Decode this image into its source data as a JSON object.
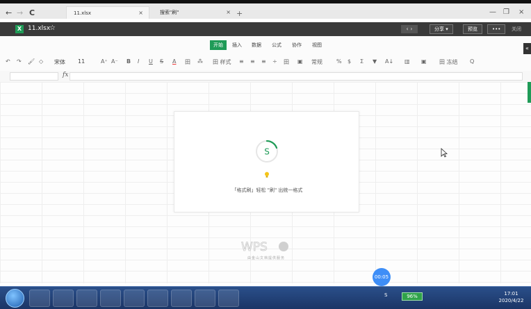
{
  "browser": {
    "back": "←",
    "forward": "→",
    "reload": "C",
    "tabs": [
      {
        "title": "11.xlsx",
        "close": "×"
      },
      {
        "title": "搜索\"刷\"",
        "close": "×"
      }
    ],
    "new_tab": "+",
    "window_controls": [
      "—",
      "❐",
      "×"
    ]
  },
  "app": {
    "file_icon_letter": "X",
    "file_name": "11.xlsx",
    "star": "☆",
    "nav_arrows": "‹ ›",
    "share_label": "分享 ▾",
    "preview_label": "预览",
    "more_label": "•••",
    "close_label": "关闭"
  },
  "ribbon": {
    "tabs": [
      "开始",
      "插入",
      "数据",
      "公式",
      "协作",
      "视图"
    ],
    "active_tab": "开始"
  },
  "toolbar": {
    "font_name": "宋体",
    "font_size": "11",
    "items": [
      "A⁺",
      "A⁻",
      "B",
      "I",
      "U",
      "S",
      "A",
      "田",
      "⁂",
      "田 样式",
      "≡",
      "≡",
      "≡",
      "÷",
      "田",
      "▣",
      "常规",
      "%",
      "$",
      "Σ",
      "▼",
      "A↓",
      "▥",
      "▣",
      "田 冻结",
      "Q"
    ]
  },
  "formula_bar": {
    "fx": "fx"
  },
  "loading": {
    "spinner_letter": "S",
    "tip": "「格式刷」轻松 \"刷\" 出统一格式"
  },
  "watermark": {
    "logo": "WPS",
    "sub": "由金山文档提供服务"
  },
  "timer": "00:05",
  "side": {
    "collapse": "«"
  },
  "taskbar": {
    "battery": "96%",
    "time": "17:01",
    "date": "2020/4/22"
  },
  "colors": {
    "accent": "#1f9b57",
    "titlebar": "#3a3a3a",
    "timer": "#3e8ef7"
  }
}
